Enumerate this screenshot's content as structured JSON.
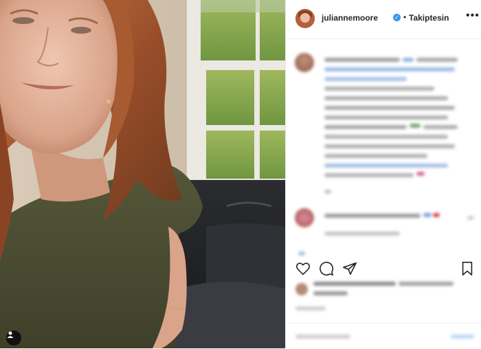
{
  "header": {
    "username": "juliannemoore",
    "verified_icon": "verified-badge-icon",
    "separator": "•",
    "follow_status": "Takiptesin",
    "more_icon": "more-options-icon"
  },
  "caption": {
    "blurred": true
  },
  "comment": {
    "blurred": true
  },
  "actions": {
    "like_icon": "heart-icon",
    "comment_icon": "comment-icon",
    "share_icon": "share-icon",
    "save_icon": "bookmark-icon"
  },
  "photo": {
    "user_tag_icon": "person-icon"
  },
  "colors": {
    "verified": "#3897f0",
    "text": "#262626",
    "border": "#efefef"
  }
}
